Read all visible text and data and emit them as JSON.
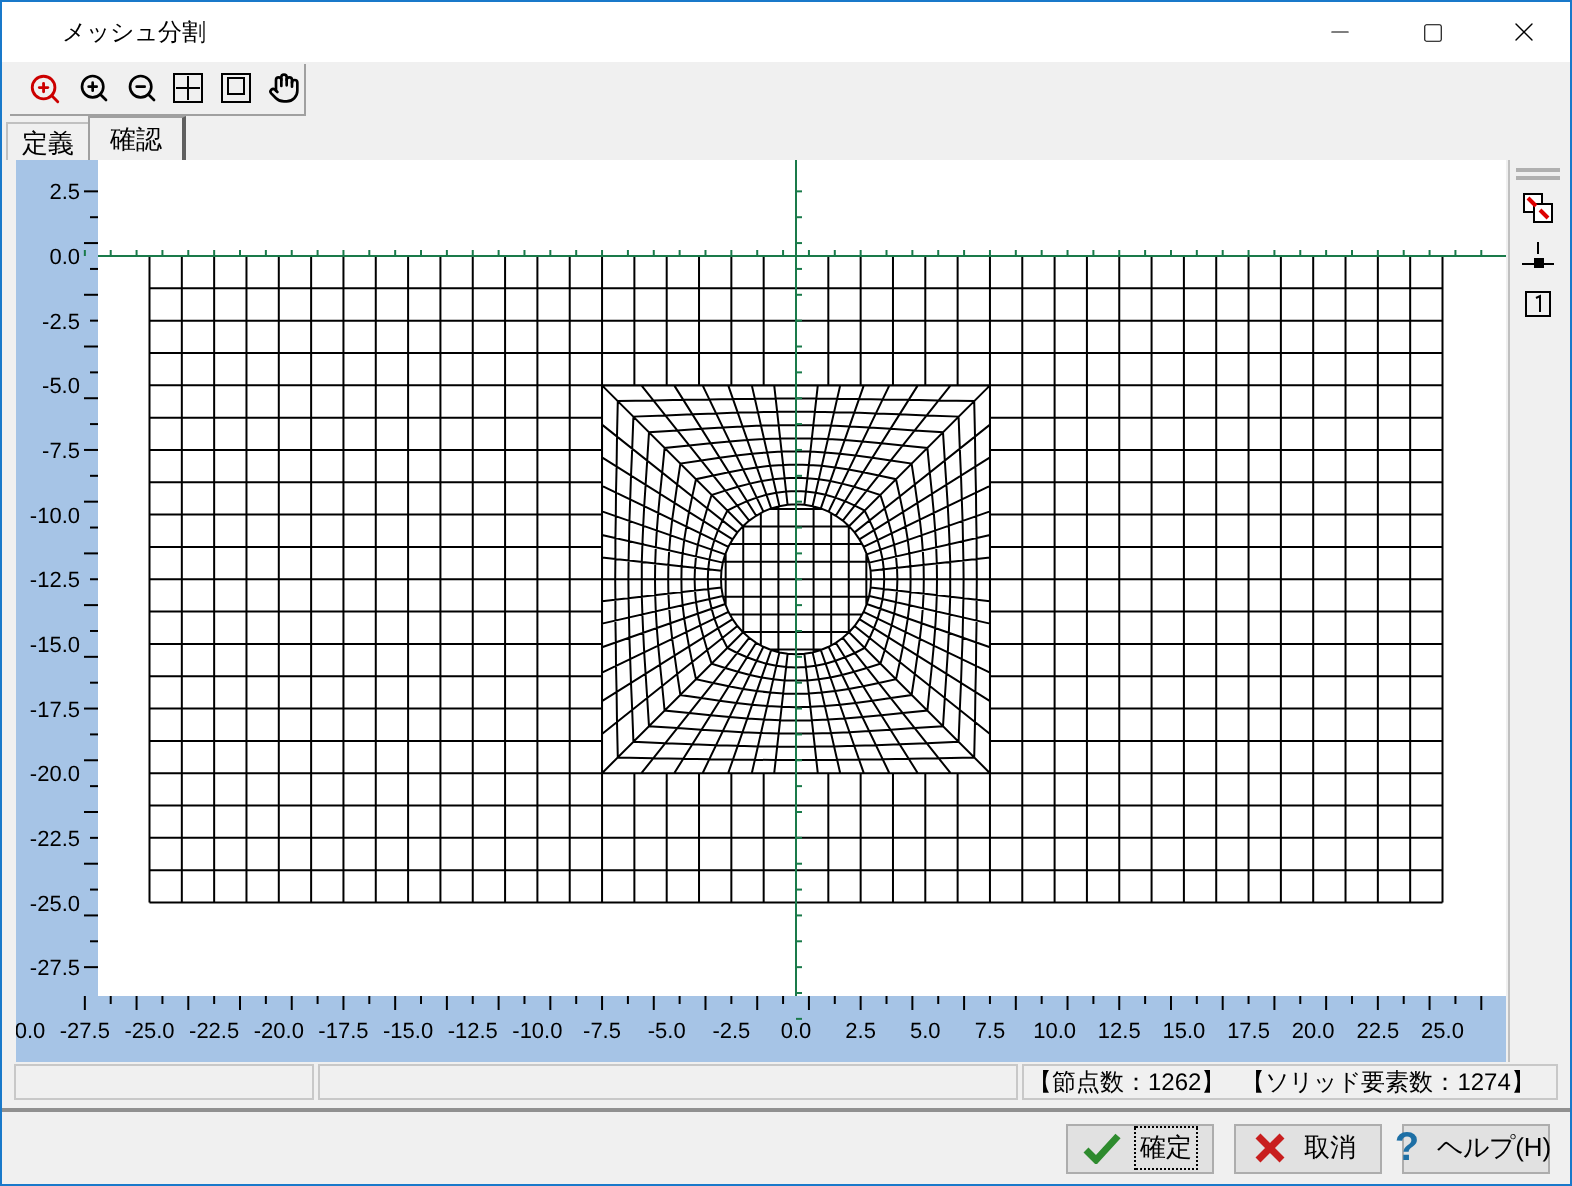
{
  "window": {
    "title": "メッシュ分割"
  },
  "tabs": [
    {
      "label": "定義",
      "selected": false
    },
    {
      "label": "確認",
      "selected": true
    }
  ],
  "plot": {
    "y_axis_labels": [
      "2.5",
      "0.0",
      "-2.5",
      "-5.0",
      "-7.5",
      "-10.0",
      "-12.5",
      "-15.0",
      "-17.5",
      "-20.0",
      "-22.5",
      "-25.0",
      "-27.5"
    ],
    "x_axis_labels": [
      "0.0",
      "-27.5",
      "-25.0",
      "-22.5",
      "-20.0",
      "-17.5",
      "-15.0",
      "-12.5",
      "-10.0",
      "-7.5",
      "-5.0",
      "-2.5",
      "0.0",
      "2.5",
      "5.0",
      "7.5",
      "10.0",
      "12.5",
      "15.0",
      "17.5",
      "20.0",
      "22.5",
      "25.0"
    ]
  },
  "status_bar": {
    "texts": [
      "【節点数：1262】",
      "【ソリッド要素数：1274】"
    ]
  },
  "buttons": [
    {
      "label": "確定",
      "kind": "ok",
      "focused": true
    },
    {
      "label": "取消",
      "kind": "cancel",
      "focused": false
    },
    {
      "label": "ヘルプ(H)",
      "kind": "help",
      "focused": false,
      "icon_text": "?"
    }
  ]
}
